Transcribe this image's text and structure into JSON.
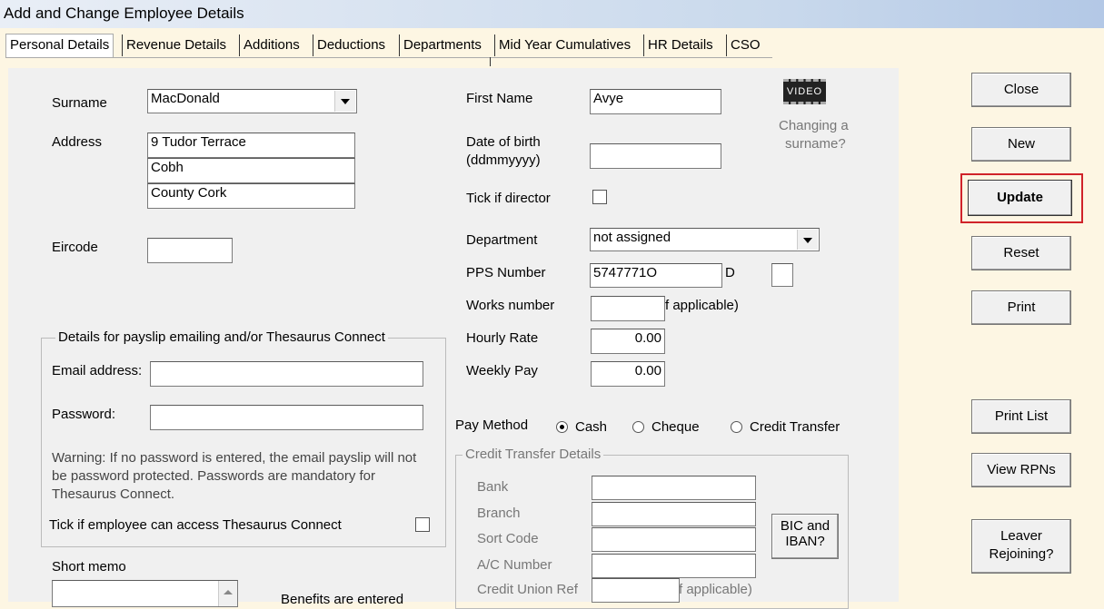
{
  "window": {
    "title": "Add and Change Employee Details"
  },
  "tabs": [
    {
      "label": "Personal Details"
    },
    {
      "label": "Revenue Details"
    },
    {
      "label": "Additions"
    },
    {
      "label": "Deductions"
    },
    {
      "label": "Departments"
    },
    {
      "label": "Mid Year Cumulatives"
    },
    {
      "label": "HR Details"
    },
    {
      "label": "CSO"
    }
  ],
  "form": {
    "surname_label": "Surname",
    "surname_value": "MacDonald",
    "address_label": "Address",
    "address_lines": [
      "9 Tudor Terrace",
      "Cobh",
      "County Cork"
    ],
    "eircode_label": "Eircode",
    "eircode_value": "",
    "first_name_label": "First Name",
    "first_name_value": "Avye",
    "dob_label_1": "Date of birth",
    "dob_label_2": "(ddmmyyyy)",
    "dob_value": "",
    "director_label": "Tick if director",
    "department_label": "Department",
    "department_value": "not assigned",
    "pps_label": "PPS Number",
    "pps_value": "5747771O",
    "pps_suffix_label": "D",
    "works_label": "Works number",
    "works_hint": "f applicable)",
    "hourly_label": "Hourly Rate",
    "hourly_value": "0.00",
    "weekly_label": "Weekly Pay",
    "weekly_value": "0.00",
    "video_label": "VIDEO",
    "video_caption_1": "Changing a",
    "video_caption_2": "surname?"
  },
  "email_group": {
    "title": "Details for payslip emailing and/or Thesaurus Connect",
    "email_label": "Email address:",
    "email_value": "",
    "password_label": "Password:",
    "password_value": "",
    "warning_1": "Warning: If no password is entered, the email payslip will not",
    "warning_2": "be password protected. Passwords are mandatory for",
    "warning_3": "Thesaurus Connect.",
    "access_label": "Tick if employee can access Thesaurus Connect"
  },
  "memo": {
    "label": "Short memo",
    "benefits_text": "Benefits are entered"
  },
  "pay_method": {
    "label": "Pay Method",
    "options": [
      "Cash",
      "Cheque",
      "Credit Transfer"
    ],
    "selected": "Cash"
  },
  "credit_transfer": {
    "title": "Credit Transfer Details",
    "bank_label": "Bank",
    "branch_label": "Branch",
    "sort_label": "Sort Code",
    "ac_label": "A/C Number",
    "cu_label": "Credit Union Ref",
    "cu_hint": "f applicable)",
    "bic_line1": "BIC and",
    "bic_line2": "IBAN?"
  },
  "buttons": {
    "close": "Close",
    "new": "New",
    "update": "Update",
    "reset": "Reset",
    "print": "Print",
    "print_list": "Print List",
    "view_rpns": "View RPNs",
    "leaver_1": "Leaver",
    "leaver_2": "Rejoining?"
  },
  "colors": {
    "highlight": "#d0232a",
    "background": "#fdf6e3",
    "panel": "#f0f0f0"
  }
}
